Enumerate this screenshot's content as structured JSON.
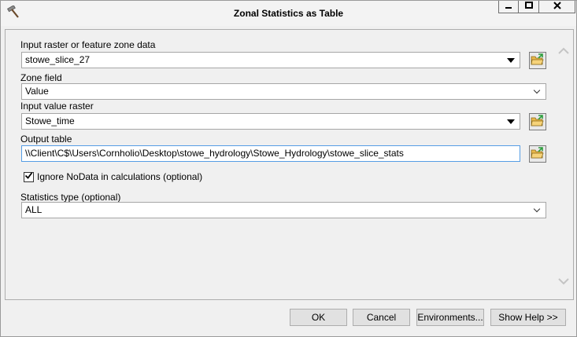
{
  "window": {
    "title": "Zonal Statistics as Table",
    "minimize": "—",
    "maximize": "□",
    "close": "✕"
  },
  "form": {
    "zone_data": {
      "label": "Input raster or feature zone data",
      "value": "stowe_slice_27"
    },
    "zone_field": {
      "label": "Zone field",
      "value": "Value"
    },
    "value_raster": {
      "label": "Input value raster",
      "value": "Stowe_time"
    },
    "output_table": {
      "label": "Output table",
      "value": "\\\\Client\\C$\\Users\\Cornholio\\Desktop\\stowe_hydrology\\Stowe_Hydrology\\stowe_slice_stats"
    },
    "ignore_nodata": {
      "label": "Ignore NoData in calculations (optional)",
      "checked": true
    },
    "statistics_type": {
      "label": "Statistics type (optional)",
      "value": "ALL"
    }
  },
  "buttons": {
    "ok": "OK",
    "cancel": "Cancel",
    "environments": "Environments...",
    "show_help": "Show Help >>"
  },
  "colors": {
    "focus_border": "#569de5",
    "folder_yellow": "#e8b84a",
    "arrow_green": "#2e9e3e"
  }
}
